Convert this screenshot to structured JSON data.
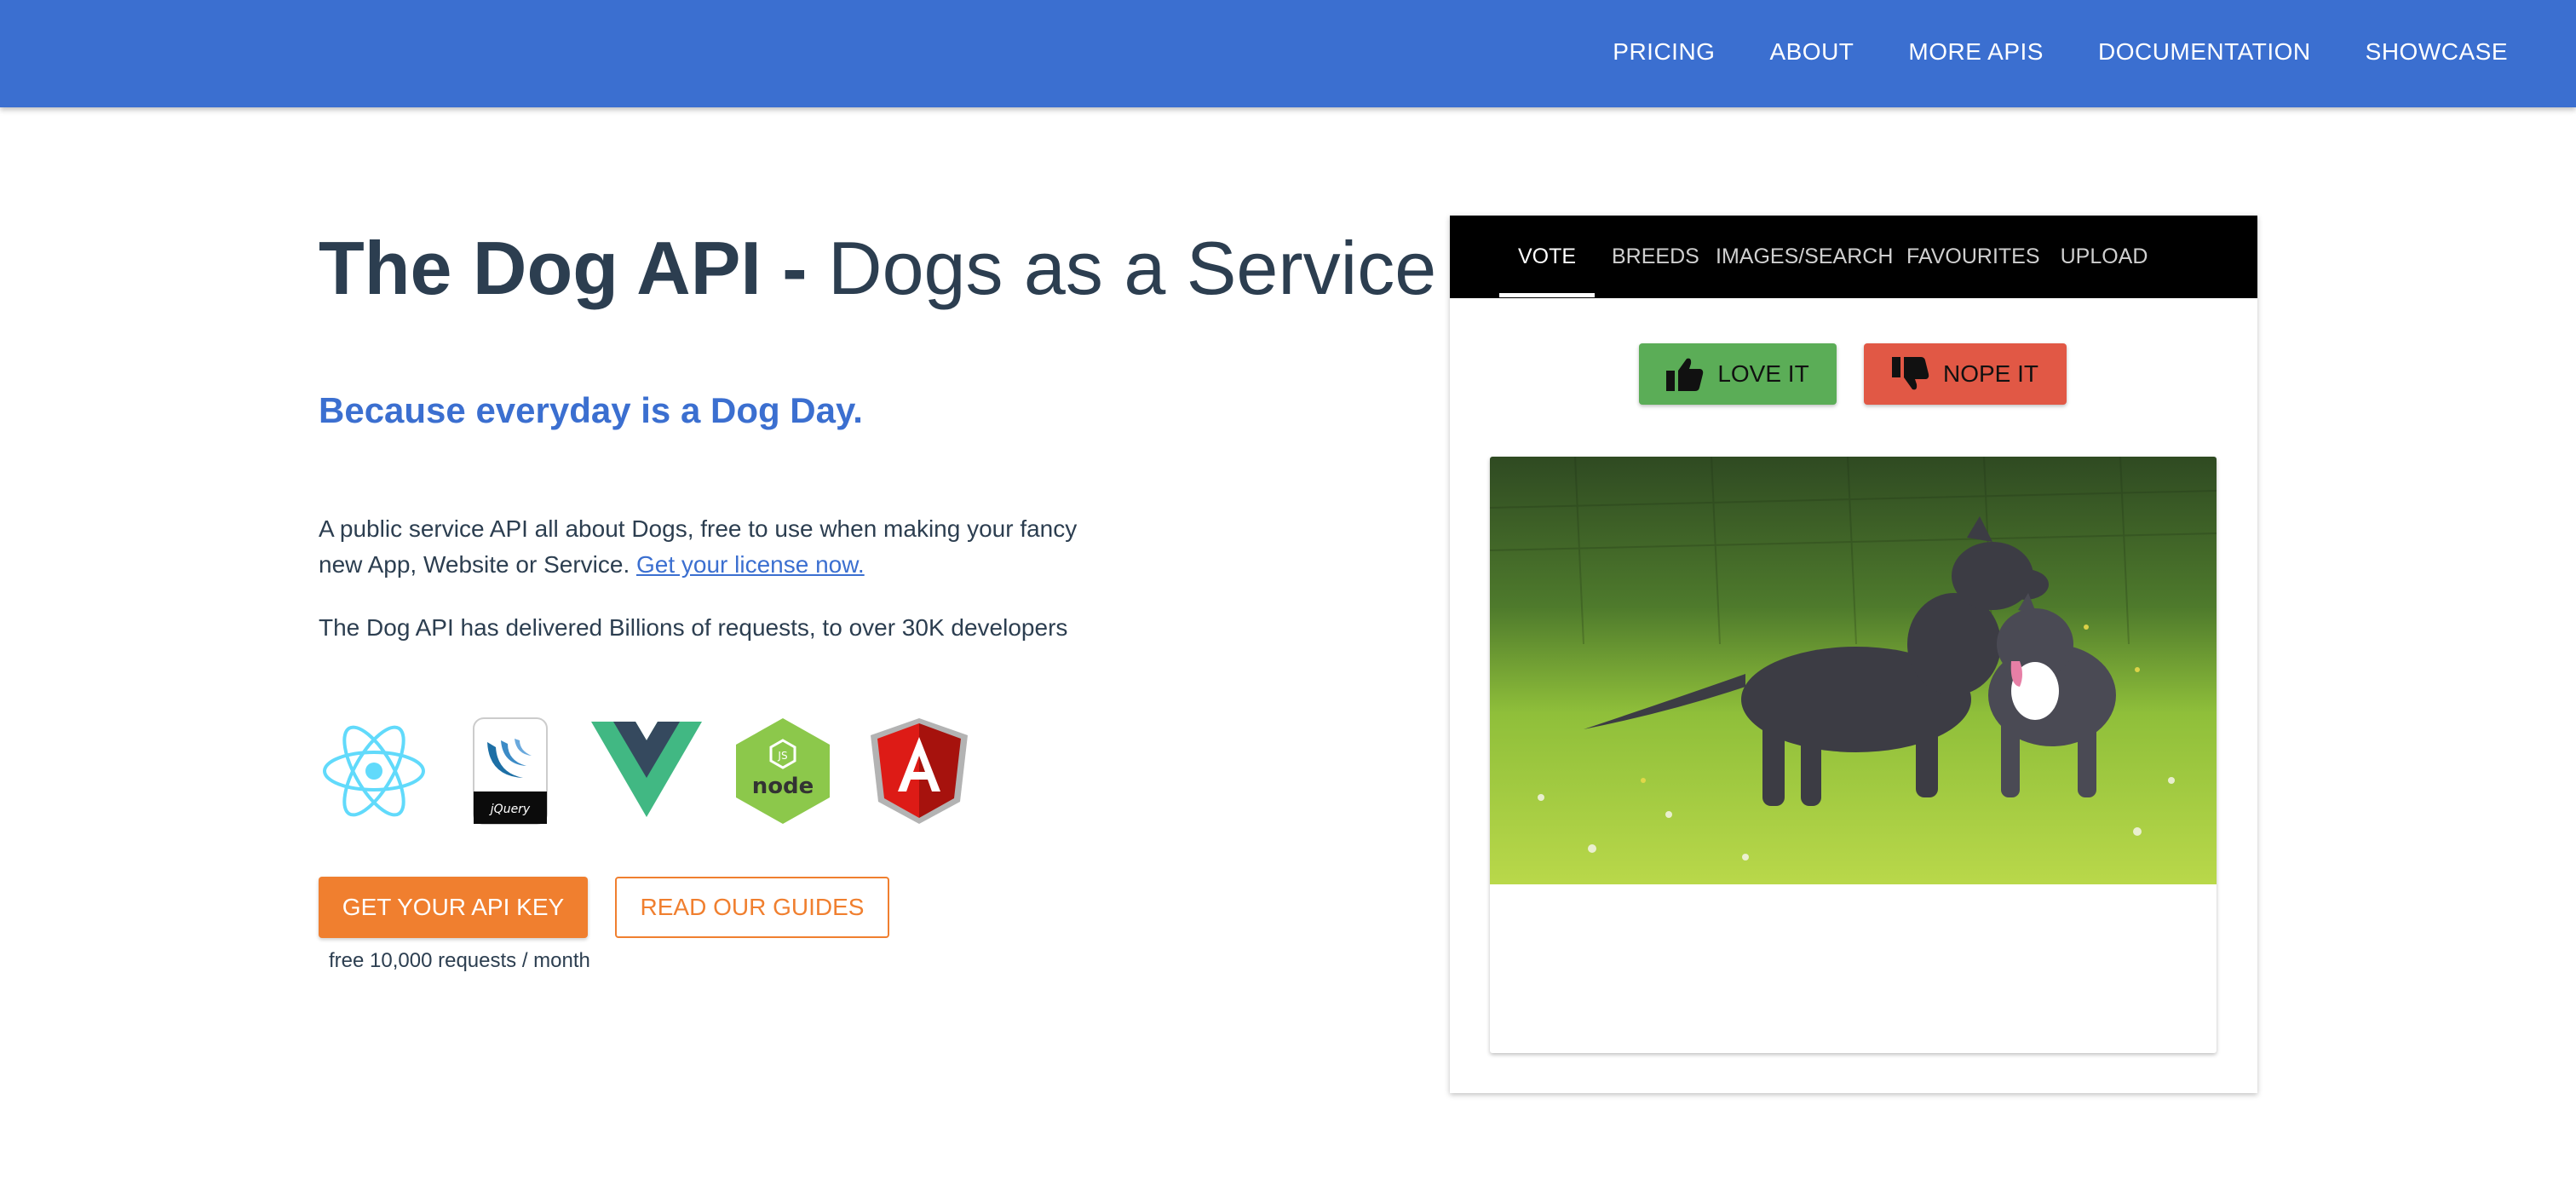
{
  "nav": {
    "items": [
      "PRICING",
      "ABOUT",
      "MORE APIS",
      "DOCUMENTATION",
      "SHOWCASE"
    ]
  },
  "hero": {
    "title_bold": "The Dog API -",
    "title_light": "Dogs as a Service",
    "tagline": "Because everyday is a Dog Day.",
    "description": "A public service API all about Dogs, free to use when making your fancy new App, Website or Service.",
    "license_link": "Get your license now.",
    "delivered": "The Dog API has delivered Billions of requests, to over 30K developers"
  },
  "logos": [
    "react-logo",
    "jquery-logo",
    "vue-logo",
    "nodejs-logo",
    "angular-logo"
  ],
  "cta": {
    "primary": "GET YOUR API KEY",
    "secondary": "READ OUR GUIDES",
    "note": "free 10,000 requests / month"
  },
  "panel": {
    "tabs": [
      "VOTE",
      "BREEDS",
      "IMAGES/SEARCH",
      "FAVOURITES",
      "UPLOAD"
    ],
    "active_tab": "VOTE",
    "love_label": "LOVE IT",
    "nope_label": "NOPE IT"
  },
  "colors": {
    "brand_blue": "#3b6fd0",
    "accent_orange": "#f07f2f",
    "love_green": "#5bad57",
    "nope_red": "#e15845",
    "text_dark": "#2c3e50"
  }
}
